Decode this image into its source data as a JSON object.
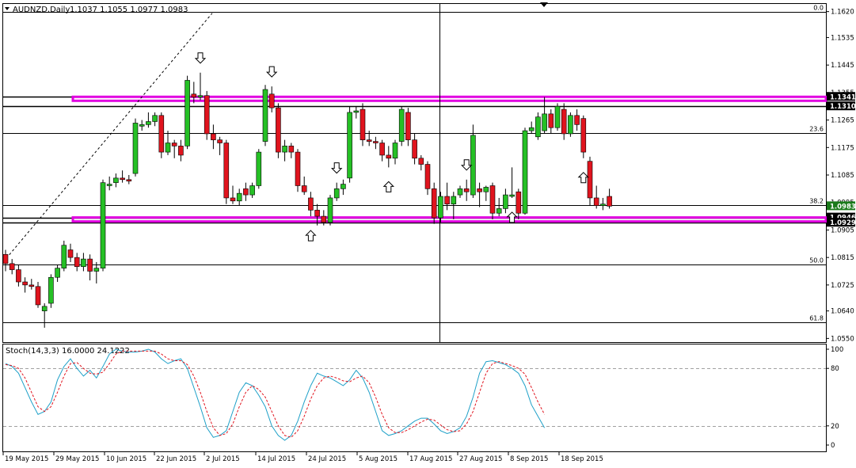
{
  "header": {
    "symbol": "AUDNZD,Daily",
    "ohlc": "1.1037 1.1055 1.0977 1.0983"
  },
  "stoch_label": "Stoch(14,3,3) 16.0000 24.1222",
  "colors": {
    "bull": "#25c025",
    "bear": "#e0141e",
    "wick": "#000000",
    "zone": "#e000e0",
    "stoch_main": "#1ea0c8",
    "stoch_signal": "#e0141e",
    "price_tag_green": "#1a7a1a",
    "price_tag_black": "#000000"
  },
  "chart_data": [
    {
      "type": "candlestick",
      "symbol": "AUDNZD",
      "timeframe": "Daily",
      "price_axis_ticks": [
        "1.1620",
        "1.1535",
        "1.1445",
        "1.1355",
        "1.1265",
        "1.1175",
        "1.1085",
        "1.0995",
        "1.0905",
        "1.0815",
        "1.0725",
        "1.0640",
        "1.0550"
      ],
      "ylim": [
        1.0538,
        1.1645
      ],
      "x_labels": [
        "19 May 2015",
        "29 May 2015",
        "10 Jun 2015",
        "22 Jun 2015",
        "2 Jul 2015",
        "14 Jul 2015",
        "24 Jul 2015",
        "5 Aug 2015",
        "17 Aug 2015",
        "27 Aug 2015",
        "8 Sep 2015",
        "18 Sep 2015"
      ],
      "fibonacci_levels": [
        {
          "label": "0.0",
          "price": 1.162
        },
        {
          "label": "23.6",
          "price": 1.1222
        },
        {
          "label": "38.2",
          "price": 1.0986
        },
        {
          "label": "50.0",
          "price": 1.0793
        },
        {
          "label": "61.8",
          "price": 1.0602
        }
      ],
      "horizontal_lines": [
        1.1341,
        1.131,
        1.0946,
        1.0929
      ],
      "zones": [
        {
          "high": 1.1341,
          "low": 1.1328
        },
        {
          "high": 1.0946,
          "low": 1.0933
        }
      ],
      "price_tags": [
        {
          "label": "1.1341",
          "price": 1.1341,
          "style": "black"
        },
        {
          "label": "1.1310",
          "price": 1.131,
          "style": "black"
        },
        {
          "label": "1.0983",
          "price": 1.0983,
          "style": "green"
        },
        {
          "label": "1.0946",
          "price": 1.0946,
          "style": "black"
        },
        {
          "label": "1.0929",
          "price": 1.0929,
          "style": "black"
        }
      ],
      "candles": [
        {
          "o": 1.0825,
          "h": 1.084,
          "l": 1.077,
          "c": 1.0795
        },
        {
          "o": 1.0795,
          "h": 1.081,
          "l": 1.076,
          "c": 1.0775
        },
        {
          "o": 1.0775,
          "h": 1.079,
          "l": 1.072,
          "c": 1.0735
        },
        {
          "o": 1.0735,
          "h": 1.075,
          "l": 1.07,
          "c": 1.0725
        },
        {
          "o": 1.0725,
          "h": 1.0745,
          "l": 1.071,
          "c": 1.072
        },
        {
          "o": 1.072,
          "h": 1.0735,
          "l": 1.065,
          "c": 1.066
        },
        {
          "o": 1.064,
          "h": 1.0665,
          "l": 1.0585,
          "c": 1.0655
        },
        {
          "o": 1.0665,
          "h": 1.076,
          "l": 1.065,
          "c": 1.075
        },
        {
          "o": 1.075,
          "h": 1.079,
          "l": 1.0735,
          "c": 1.078
        },
        {
          "o": 1.078,
          "h": 1.087,
          "l": 1.077,
          "c": 1.0855
        },
        {
          "o": 1.084,
          "h": 1.086,
          "l": 1.08,
          "c": 1.0815
        },
        {
          "o": 1.0815,
          "h": 1.083,
          "l": 1.077,
          "c": 1.0785
        },
        {
          "o": 1.0785,
          "h": 1.083,
          "l": 1.077,
          "c": 1.081
        },
        {
          "o": 1.081,
          "h": 1.0825,
          "l": 1.074,
          "c": 1.077
        },
        {
          "o": 1.077,
          "h": 1.08,
          "l": 1.073,
          "c": 1.078
        },
        {
          "o": 1.078,
          "h": 1.107,
          "l": 1.077,
          "c": 1.106
        },
        {
          "o": 1.105,
          "h": 1.108,
          "l": 1.1035,
          "c": 1.1055
        },
        {
          "o": 1.106,
          "h": 1.109,
          "l": 1.1045,
          "c": 1.1075
        },
        {
          "o": 1.1075,
          "h": 1.11,
          "l": 1.106,
          "c": 1.107
        },
        {
          "o": 1.107,
          "h": 1.1085,
          "l": 1.1055,
          "c": 1.1065
        },
        {
          "o": 1.109,
          "h": 1.127,
          "l": 1.108,
          "c": 1.1255
        },
        {
          "o": 1.1245,
          "h": 1.1265,
          "l": 1.123,
          "c": 1.125
        },
        {
          "o": 1.125,
          "h": 1.129,
          "l": 1.124,
          "c": 1.126
        },
        {
          "o": 1.126,
          "h": 1.129,
          "l": 1.1245,
          "c": 1.128
        },
        {
          "o": 1.128,
          "h": 1.129,
          "l": 1.114,
          "c": 1.116
        },
        {
          "o": 1.116,
          "h": 1.123,
          "l": 1.115,
          "c": 1.119
        },
        {
          "o": 1.119,
          "h": 1.12,
          "l": 1.114,
          "c": 1.118
        },
        {
          "o": 1.118,
          "h": 1.12,
          "l": 1.113,
          "c": 1.115
        },
        {
          "o": 1.118,
          "h": 1.141,
          "l": 1.117,
          "c": 1.1395
        },
        {
          "o": 1.135,
          "h": 1.139,
          "l": 1.132,
          "c": 1.134
        },
        {
          "o": 1.134,
          "h": 1.142,
          "l": 1.133,
          "c": 1.1345
        },
        {
          "o": 1.1345,
          "h": 1.136,
          "l": 1.12,
          "c": 1.122
        },
        {
          "o": 1.122,
          "h": 1.125,
          "l": 1.117,
          "c": 1.12
        },
        {
          "o": 1.12,
          "h": 1.121,
          "l": 1.115,
          "c": 1.119
        },
        {
          "o": 1.119,
          "h": 1.12,
          "l": 1.099,
          "c": 1.101
        },
        {
          "o": 1.101,
          "h": 1.105,
          "l": 1.099,
          "c": 1.1
        },
        {
          "o": 1.1,
          "h": 1.104,
          "l": 1.0985,
          "c": 1.1025
        },
        {
          "o": 1.104,
          "h": 1.106,
          "l": 1.1,
          "c": 1.102
        },
        {
          "o": 1.102,
          "h": 1.106,
          "l": 1.101,
          "c": 1.105
        },
        {
          "o": 1.105,
          "h": 1.117,
          "l": 1.104,
          "c": 1.116
        },
        {
          "o": 1.1195,
          "h": 1.138,
          "l": 1.118,
          "c": 1.1365
        },
        {
          "o": 1.135,
          "h": 1.1375,
          "l": 1.129,
          "c": 1.1305
        },
        {
          "o": 1.1305,
          "h": 1.132,
          "l": 1.114,
          "c": 1.116
        },
        {
          "o": 1.116,
          "h": 1.12,
          "l": 1.113,
          "c": 1.118
        },
        {
          "o": 1.118,
          "h": 1.119,
          "l": 1.114,
          "c": 1.116
        },
        {
          "o": 1.116,
          "h": 1.117,
          "l": 1.103,
          "c": 1.105
        },
        {
          "o": 1.105,
          "h": 1.108,
          "l": 1.102,
          "c": 1.103
        },
        {
          "o": 1.101,
          "h": 1.103,
          "l": 1.095,
          "c": 1.097
        },
        {
          "o": 1.097,
          "h": 1.099,
          "l": 1.092,
          "c": 1.095
        },
        {
          "o": 1.095,
          "h": 1.097,
          "l": 1.092,
          "c": 1.093
        },
        {
          "o": 1.093,
          "h": 1.102,
          "l": 1.092,
          "c": 1.101
        },
        {
          "o": 1.101,
          "h": 1.106,
          "l": 1.1,
          "c": 1.104
        },
        {
          "o": 1.104,
          "h": 1.107,
          "l": 1.102,
          "c": 1.1055
        },
        {
          "o": 1.1075,
          "h": 1.131,
          "l": 1.106,
          "c": 1.129
        },
        {
          "o": 1.129,
          "h": 1.131,
          "l": 1.127,
          "c": 1.1295
        },
        {
          "o": 1.13,
          "h": 1.132,
          "l": 1.118,
          "c": 1.12
        },
        {
          "o": 1.12,
          "h": 1.123,
          "l": 1.118,
          "c": 1.1195
        },
        {
          "o": 1.1195,
          "h": 1.121,
          "l": 1.117,
          "c": 1.119
        },
        {
          "o": 1.119,
          "h": 1.12,
          "l": 1.113,
          "c": 1.115
        },
        {
          "o": 1.115,
          "h": 1.118,
          "l": 1.111,
          "c": 1.114
        },
        {
          "o": 1.114,
          "h": 1.12,
          "l": 1.112,
          "c": 1.119
        },
        {
          "o": 1.1195,
          "h": 1.131,
          "l": 1.118,
          "c": 1.13
        },
        {
          "o": 1.129,
          "h": 1.1305,
          "l": 1.118,
          "c": 1.12
        },
        {
          "o": 1.12,
          "h": 1.122,
          "l": 1.112,
          "c": 1.114
        },
        {
          "o": 1.114,
          "h": 1.115,
          "l": 1.11,
          "c": 1.112
        },
        {
          "o": 1.112,
          "h": 1.113,
          "l": 1.102,
          "c": 1.104
        },
        {
          "o": 1.104,
          "h": 1.106,
          "l": 1.0925,
          "c": 1.0945
        },
        {
          "o": 1.0945,
          "h": 1.103,
          "l": 1.093,
          "c": 1.1015
        },
        {
          "o": 1.1015,
          "h": 1.106,
          "l": 1.097,
          "c": 1.099
        },
        {
          "o": 1.099,
          "h": 1.103,
          "l": 1.094,
          "c": 1.1015
        },
        {
          "o": 1.102,
          "h": 1.105,
          "l": 1.101,
          "c": 1.104
        },
        {
          "o": 1.104,
          "h": 1.107,
          "l": 1.1,
          "c": 1.103
        },
        {
          "o": 1.102,
          "h": 1.125,
          "l": 1.101,
          "c": 1.1215
        },
        {
          "o": 1.104,
          "h": 1.106,
          "l": 1.098,
          "c": 1.103
        },
        {
          "o": 1.103,
          "h": 1.105,
          "l": 1.1,
          "c": 1.1045
        },
        {
          "o": 1.105,
          "h": 1.106,
          "l": 1.094,
          "c": 1.096
        },
        {
          "o": 1.096,
          "h": 1.101,
          "l": 1.095,
          "c": 1.0975
        },
        {
          "o": 1.0975,
          "h": 1.104,
          "l": 1.096,
          "c": 1.102
        },
        {
          "o": 1.1015,
          "h": 1.111,
          "l": 1.101,
          "c": 1.102
        },
        {
          "o": 1.103,
          "h": 1.104,
          "l": 1.094,
          "c": 1.096
        },
        {
          "o": 1.096,
          "h": 1.124,
          "l": 1.0955,
          "c": 1.123
        },
        {
          "o": 1.123,
          "h": 1.126,
          "l": 1.122,
          "c": 1.124
        },
        {
          "o": 1.121,
          "h": 1.129,
          "l": 1.12,
          "c": 1.1275
        },
        {
          "o": 1.123,
          "h": 1.134,
          "l": 1.122,
          "c": 1.1285
        },
        {
          "o": 1.1285,
          "h": 1.13,
          "l": 1.122,
          "c": 1.124
        },
        {
          "o": 1.124,
          "h": 1.132,
          "l": 1.123,
          "c": 1.131
        },
        {
          "o": 1.13,
          "h": 1.132,
          "l": 1.12,
          "c": 1.122
        },
        {
          "o": 1.122,
          "h": 1.129,
          "l": 1.121,
          "c": 1.128
        },
        {
          "o": 1.128,
          "h": 1.13,
          "l": 1.123,
          "c": 1.125
        },
        {
          "o": 1.127,
          "h": 1.128,
          "l": 1.114,
          "c": 1.116
        },
        {
          "o": 1.113,
          "h": 1.1145,
          "l": 1.0985,
          "c": 1.101
        },
        {
          "o": 1.101,
          "h": 1.105,
          "l": 1.0975,
          "c": 1.0985
        },
        {
          "o": 1.0985,
          "h": 1.101,
          "l": 1.097,
          "c": 1.099
        },
        {
          "o": 1.1015,
          "h": 1.104,
          "l": 1.0975,
          "c": 1.0983
        }
      ],
      "arrows_down_at_candle": [
        30,
        41,
        51,
        71
      ],
      "arrows_up_at_candle": [
        47,
        59,
        78,
        89
      ]
    },
    {
      "type": "line",
      "name": "Stoch(14,3,3)",
      "levels": [
        80,
        20
      ],
      "axis_ticks": [
        "100",
        "80",
        "20",
        "0"
      ],
      "ylim": [
        0,
        100
      ],
      "series": [
        {
          "name": "main",
          "values": [
            85,
            82,
            75,
            60,
            45,
            32,
            35,
            45,
            68,
            82,
            90,
            80,
            72,
            78,
            70,
            82,
            95,
            100,
            98,
            97,
            97,
            98,
            100,
            97,
            90,
            85,
            88,
            90,
            80,
            60,
            40,
            18,
            8,
            10,
            15,
            35,
            55,
            65,
            62,
            52,
            40,
            20,
            10,
            5,
            10,
            25,
            45,
            62,
            75,
            72,
            70,
            66,
            62,
            68,
            78,
            70,
            55,
            35,
            15,
            10,
            12,
            15,
            20,
            25,
            28,
            28,
            22,
            15,
            12,
            14,
            18,
            30,
            50,
            75,
            87,
            88,
            86,
            84,
            80,
            75,
            62,
            42,
            30,
            18
          ]
        },
        {
          "name": "signal",
          "values": [
            84,
            83,
            80,
            70,
            55,
            40,
            35,
            40,
            55,
            72,
            85,
            86,
            80,
            75,
            74,
            76,
            85,
            95,
            98,
            98,
            98,
            98,
            98,
            98,
            95,
            90,
            88,
            88,
            84,
            72,
            55,
            35,
            18,
            10,
            12,
            22,
            40,
            55,
            62,
            58,
            50,
            35,
            20,
            10,
            8,
            15,
            30,
            48,
            62,
            70,
            72,
            70,
            67,
            66,
            70,
            72,
            65,
            50,
            32,
            18,
            13,
            13,
            16,
            20,
            24,
            27,
            26,
            21,
            16,
            14,
            15,
            22,
            35,
            55,
            75,
            85,
            87,
            85,
            83,
            80,
            74,
            60,
            45,
            32
          ]
        }
      ]
    }
  ]
}
